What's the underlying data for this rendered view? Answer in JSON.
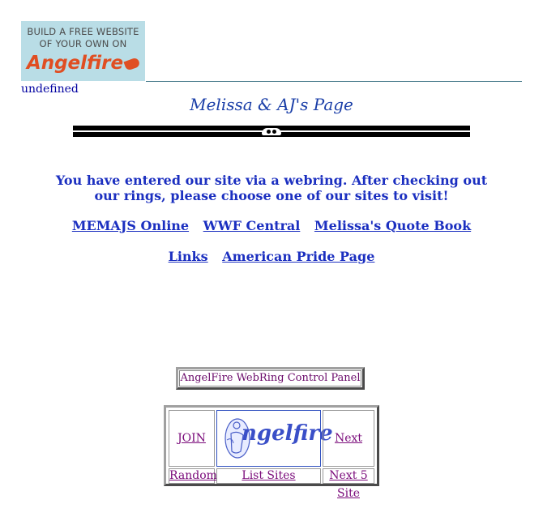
{
  "banner": {
    "line1": "BUILD A FREE WEBSITE",
    "line2": "OF YOUR OWN ON",
    "brand": "Angelfire"
  },
  "undefined_text": "undefined",
  "page_title": "Melissa & AJ's Page",
  "message": "You have entered our site via a webring. After checking out our rings, please choose one of our sites to visit!",
  "site_links_row1": [
    "MEMAJS Online",
    "WWF Central",
    "Melissa's Quote Book"
  ],
  "site_links_row2": [
    "Links",
    "American Pride Page"
  ],
  "control_panel_label": "AngelFire WebRing Control Panel",
  "webring": {
    "join": "JOIN",
    "logo": "ngelfire",
    "next_site": "Next Site",
    "random": "Random",
    "list_sites": "List Sites",
    "next_5": "Next 5"
  },
  "colors": {
    "link": "#1b2fc0",
    "visited": "#7a0a7a",
    "title": "#1b3fa8",
    "banner_bg": "#b9dde6",
    "brand": "#e04e22"
  }
}
